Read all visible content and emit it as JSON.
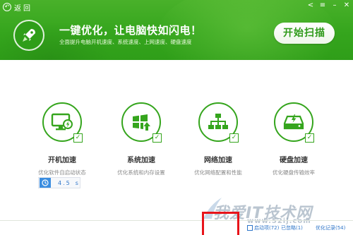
{
  "header": {
    "back_label": "返回",
    "headline": "一键优化，让电脑快如闪电！",
    "subline": "全面提升电脑开机速度、系统速度、上网速度、硬盘速度",
    "start_button": "开始扫描",
    "window_controls": [
      "share-icon",
      "menu-icon",
      "minimize-icon",
      "close-icon"
    ]
  },
  "features": [
    {
      "title": "开机加速",
      "desc": "优化软件自启动状态",
      "icon": "monitor-lightning-icon",
      "checked": true
    },
    {
      "title": "系统加速",
      "desc": "优化系统和内存设置",
      "icon": "windows-up-icon",
      "checked": true
    },
    {
      "title": "网络加速",
      "desc": "优化网络配置和性能",
      "icon": "network-icon",
      "checked": true
    },
    {
      "title": "硬盘加速",
      "desc": "优化硬盘传输效率",
      "icon": "hard-disk-lightning-icon",
      "checked": true
    }
  ],
  "boot_time": {
    "value": "4.5",
    "unit": "s"
  },
  "footer": {
    "links": [
      "启动项(72)",
      "已忽略(1)",
      "优化记录(54)"
    ]
  },
  "watermark": {
    "text": "我爱IT技术网",
    "url": "www.52ij.com"
  },
  "colors": {
    "brand_green": "#35a51d",
    "link_blue": "#2f76c9",
    "highlight_red": "#e8141a"
  }
}
